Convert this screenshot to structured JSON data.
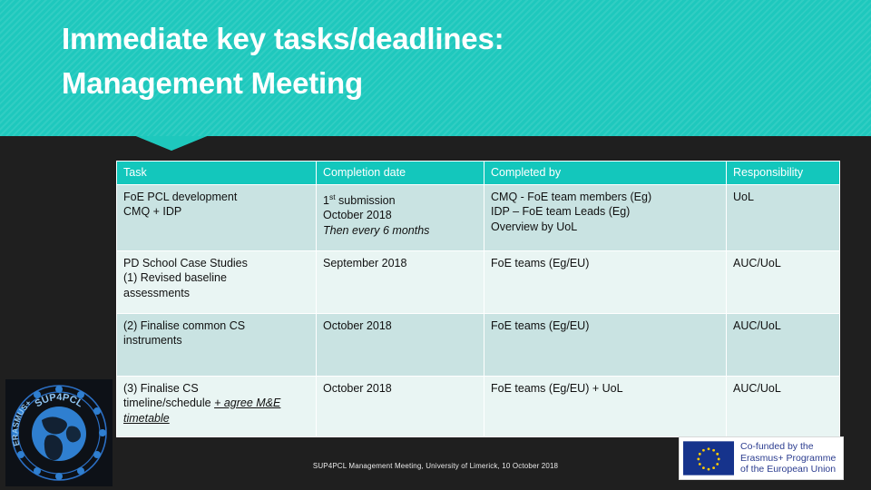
{
  "slide": {
    "title": "Immediate key tasks/deadlines:\nManagement Meeting",
    "banner_color": "#1ec8bd",
    "background_color": "#1f1f1f",
    "header_row_color": "#13c7bc"
  },
  "table": {
    "headers": [
      "Task",
      "Completion date",
      "Completed by",
      "Responsibility"
    ],
    "rows": [
      {
        "task": "FoE PCL development\nCMQ + IDP",
        "completion_date_line1_number": "1",
        "completion_date_line1_sup": "st",
        "completion_date_line1_rest": " submission",
        "completion_date_line2": "October 2018",
        "completion_date_line3_italic": "Then every 6 months",
        "completed_by": "CMQ - FoE team members (Eg)\nIDP – FoE team Leads (Eg)\nOverview by UoL",
        "responsibility": "UoL"
      },
      {
        "task": "PD School Case Studies\n(1) Revised baseline\nassessments",
        "completion_date": "September 2018",
        "completed_by": "FoE teams (Eg/EU)",
        "responsibility": "AUC/UoL"
      },
      {
        "task": "(2) Finalise common CS\ninstruments",
        "completion_date": "October 2018",
        "completed_by": "FoE teams (Eg/EU)",
        "responsibility": "AUC/UoL"
      },
      {
        "task_plain": "(3) Finalise CS\ntimeline/schedule ",
        "task_emphasis": "+ agree M&E timetable ",
        "completion_date": "October 2018",
        "completed_by": "FoE teams (Eg/EU) + UoL",
        "responsibility": "AUC/UoL"
      }
    ]
  },
  "footer": {
    "note": "SUP4PCL Management Meeting, University of Limerick, 10 October 2018"
  },
  "logos": {
    "sup4pcl": {
      "top_text": "SUP4PCL",
      "arc_text": "ERASMUS+"
    },
    "eu": {
      "text": "Co-funded by the\nErasmus+ Programme\nof the European Union",
      "flag_color": "#16338c",
      "star_color": "#ffcc00"
    }
  }
}
